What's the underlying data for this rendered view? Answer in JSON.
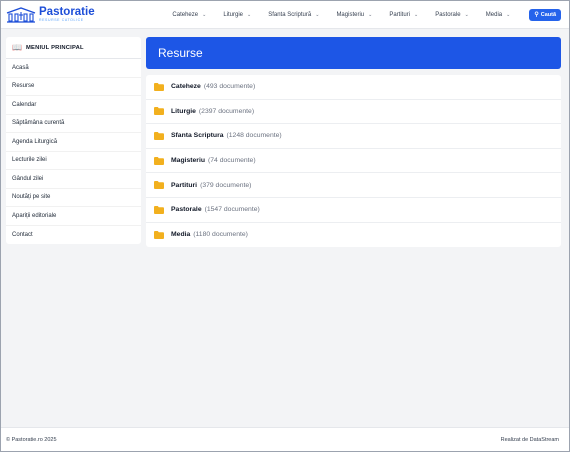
{
  "brand": {
    "title": "Pastoratie",
    "subtitle": "Resurse catolice"
  },
  "nav": [
    {
      "label": "Cateheze"
    },
    {
      "label": "Liturgie"
    },
    {
      "label": "Sfanta Scriptură"
    },
    {
      "label": "Magisteriu"
    },
    {
      "label": "Partituri"
    },
    {
      "label": "Pastorale"
    },
    {
      "label": "Media"
    }
  ],
  "search": {
    "label": "Caută"
  },
  "sidebar": {
    "title": "MENIUL PRINCIPAL",
    "items": [
      {
        "label": "Acasă"
      },
      {
        "label": "Resurse"
      },
      {
        "label": "Calendar"
      },
      {
        "label": "Săptămâna curentă"
      },
      {
        "label": "Agenda Liturgică"
      },
      {
        "label": "Lecturile zilei"
      },
      {
        "label": "Gândul zilei"
      },
      {
        "label": "Noutăți pe site"
      },
      {
        "label": "Apariții editoriale"
      },
      {
        "label": "Contact"
      }
    ]
  },
  "main": {
    "title": "Resurse",
    "folders": [
      {
        "name": "Cateheze",
        "count": "(493 documente)"
      },
      {
        "name": "Liturgie",
        "count": "(2397 documente)"
      },
      {
        "name": "Sfanta Scriptura",
        "count": "(1248 documente)"
      },
      {
        "name": "Magisteriu",
        "count": "(74 documente)"
      },
      {
        "name": "Partituri",
        "count": "(379 documente)"
      },
      {
        "name": "Pastorale",
        "count": "(1547 documente)"
      },
      {
        "name": "Media",
        "count": "(1180 documente)"
      }
    ]
  },
  "footer": {
    "left": "© Pastoratie.ro 2025",
    "right": "Realizat de DataStream"
  },
  "colors": {
    "accent": "#1d56e6",
    "folder": "#f2b01e",
    "brand": "#1d4ed8"
  }
}
